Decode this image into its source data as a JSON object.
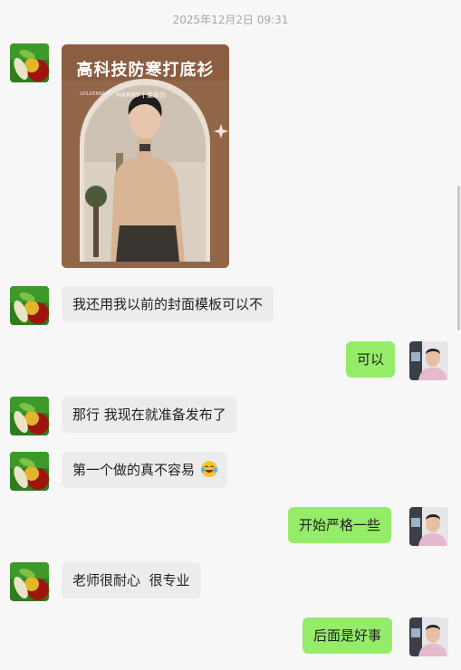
{
  "timestamp": "2025年12月2日 09:31",
  "poster": {
    "title": "高科技防寒打底衫",
    "small_text_left": "GOLDENBABY",
    "small_text_right": "HARRY | 金和白"
  },
  "colors": {
    "background": "#f7f7f7",
    "incoming_bubble": "#ececec",
    "outgoing_bubble": "#95ec69",
    "timestamp_text": "#a6a6a6"
  },
  "messages": [
    {
      "side": "in",
      "type": "image",
      "icon": "poster-image"
    },
    {
      "side": "in",
      "type": "text",
      "text": "我还用我以前的封面模板可以不"
    },
    {
      "side": "out",
      "type": "text",
      "text": "可以"
    },
    {
      "side": "in",
      "type": "text",
      "text": "那行 我现在就准备发布了"
    },
    {
      "side": "in",
      "type": "text",
      "text": "第一个做的真不容易",
      "emoji": "laugh-cry-emoji"
    },
    {
      "side": "out",
      "type": "text",
      "text": "开始严格一些"
    },
    {
      "side": "in",
      "type": "text",
      "text": "老师很耐心  很专业"
    },
    {
      "side": "out",
      "type": "text",
      "text": "后面是好事"
    }
  ]
}
